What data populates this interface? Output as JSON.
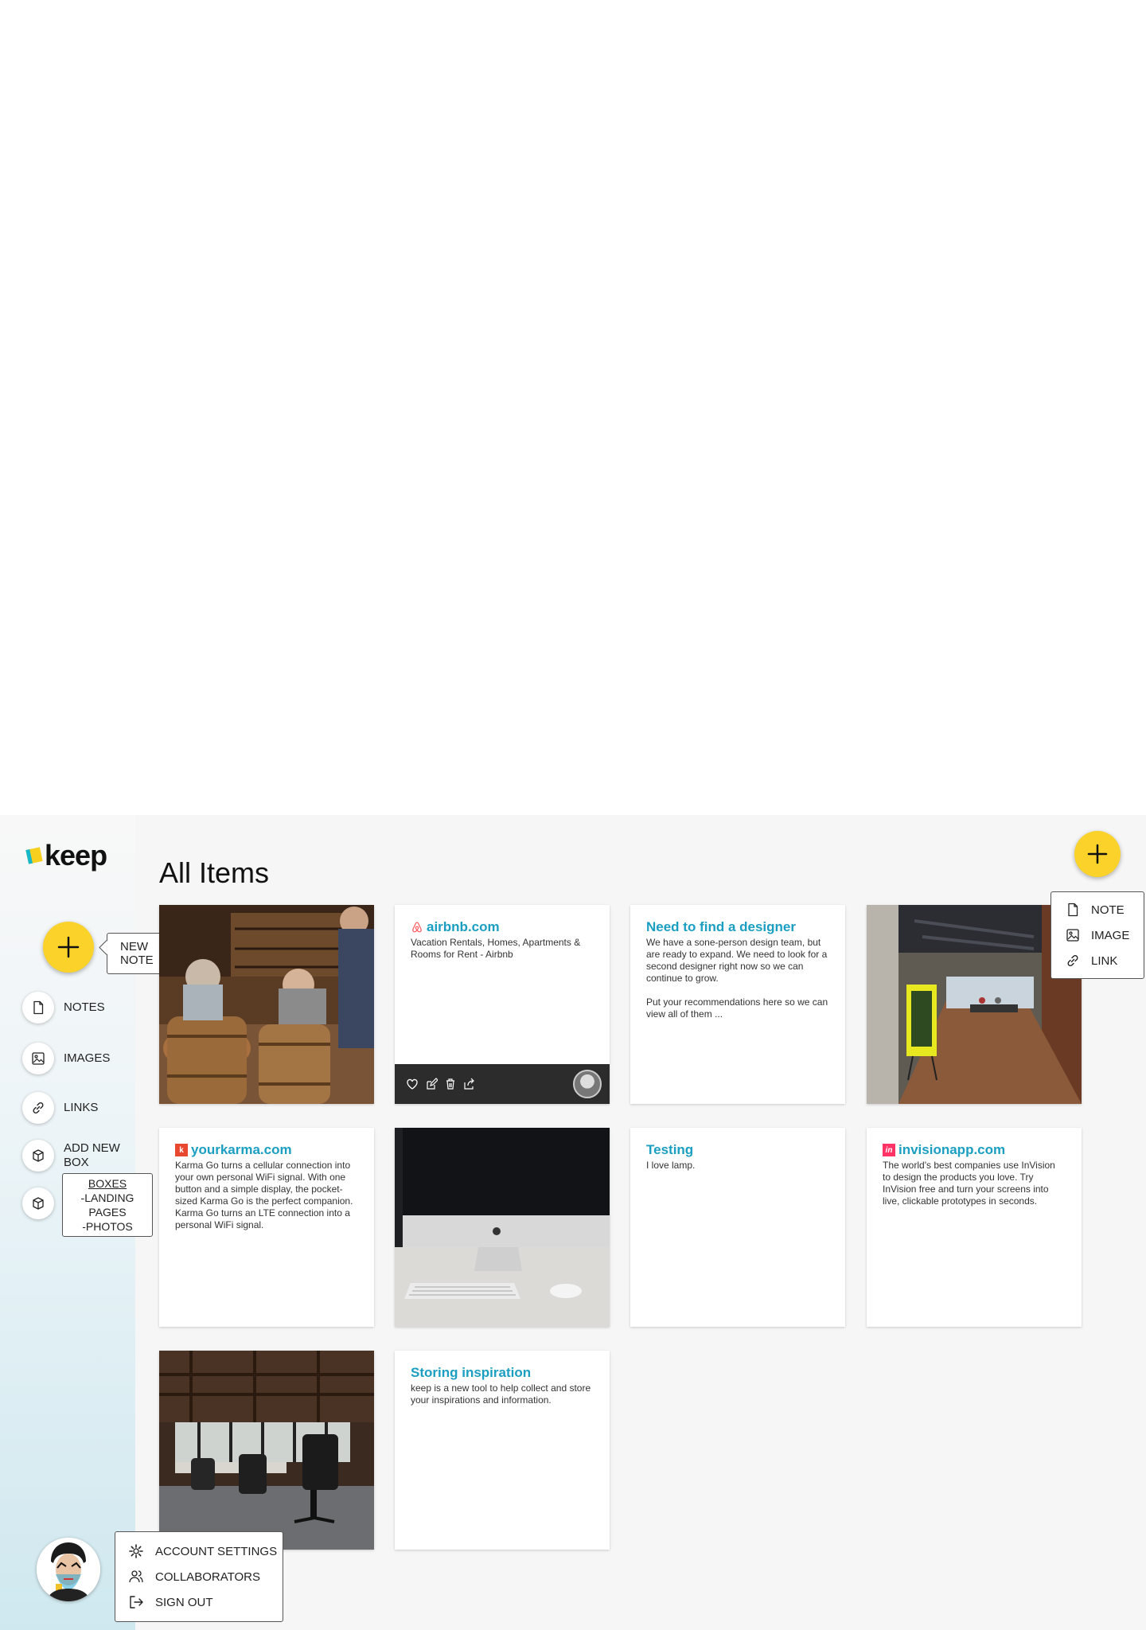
{
  "app": {
    "brand": "keep",
    "page_title": "All Items"
  },
  "sidebar": {
    "new_note_tooltip": "NEW NOTE",
    "items": [
      {
        "label": "NOTES",
        "icon": "note-icon"
      },
      {
        "label": "IMAGES",
        "icon": "image-icon"
      },
      {
        "label": "LINKS",
        "icon": "link-icon"
      },
      {
        "label": "ADD NEW BOX",
        "icon": "add-box-icon"
      },
      {
        "label": "",
        "icon": "box-icon"
      }
    ],
    "boxes_popup": {
      "heading": "BOXES",
      "entries": [
        "-LANDING PAGES",
        "-PHOTOS"
      ]
    }
  },
  "add_menu": {
    "items": [
      "NOTE",
      "IMAGE",
      "LINK"
    ]
  },
  "account_menu": {
    "items": [
      "ACCOUNT SETTINGS",
      "COLLABORATORS",
      "SIGN OUT"
    ]
  },
  "cards": {
    "airbnb": {
      "title": "airbnb.com",
      "body": "Vacation Rentals, Homes, Apartments & Rooms for Rent - Airbnb"
    },
    "designer": {
      "title": "Need to find a designer",
      "body": "We have a sone-person design team, but are ready to expand. We need to look for a second designer right now so we can continue to grow.\n\nPut your recommendations here so we can view all of them ..."
    },
    "yourkarma": {
      "title": "yourkarma.com",
      "body": "Karma Go turns a cellular connection into your own personal WiFi signal. With one button and a simple display, the pocket-sized Karma Go is the perfect companion. Karma Go turns an LTE connection into a personal WiFi signal."
    },
    "testing": {
      "title": "Testing",
      "body": "I love lamp."
    },
    "invision": {
      "title": "invisionapp.com",
      "body": "The world's best companies use InVision to design the products you love. Try InVision free and turn your screens into live, clickable prototypes in seconds."
    },
    "storing": {
      "title": "Storing inspiration",
      "body": "keep is a new tool to help collect and store your inspirations and information."
    }
  },
  "colors": {
    "accent": "#fbd22a",
    "link_title": "#1a9ec2",
    "toolbar": "#2c2c2c",
    "airbnb": "#ff5a5f",
    "karma": "#e8482e",
    "invision": "#ff3366"
  }
}
